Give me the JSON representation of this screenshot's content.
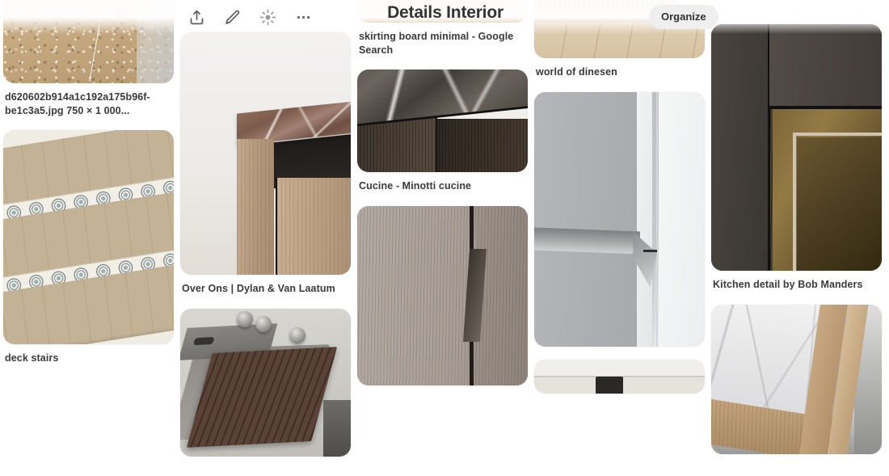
{
  "header": {
    "title": "Details Interior",
    "organize_label": "Organize",
    "tools": [
      {
        "name": "share-icon",
        "label": "Share"
      },
      {
        "name": "edit-pencil-icon",
        "label": "Edit"
      },
      {
        "name": "sparkle-icon",
        "label": "More ideas"
      },
      {
        "name": "more-options-icon",
        "label": "More options"
      }
    ]
  },
  "columns": [
    {
      "id": "column-1",
      "pins": [
        {
          "caption": "d620602b914a1c192a175b96f-be1c3a5.jpg 750 × 1 000...",
          "alt": "Terrazzo floor with wooden door frame"
        },
        {
          "caption": "deck stairs",
          "alt": "Wooden stairs with patterned tile risers"
        }
      ]
    },
    {
      "id": "column-2",
      "pins": [
        {
          "caption": "Over Ons | Dylan & Van Laatum",
          "alt": "Brown marble countertop on oak cabinet with black recess"
        },
        {
          "caption": "",
          "alt": "Concrete sink with dark wood slatted cover and metal knobs"
        }
      ]
    },
    {
      "id": "column-3",
      "pins": [
        {
          "caption": "skirting board minimal - Google Search",
          "alt": "Light wood floor with minimal white skirting board"
        },
        {
          "caption": "Cucine - Minotti cucine",
          "alt": "Dark marble countertop corner on dark wood cabinetry"
        },
        {
          "caption": "",
          "alt": "Grey wood grain cabinet doors with recessed groove handle"
        }
      ]
    },
    {
      "id": "column-4",
      "pins": [
        {
          "caption": "world of dinesen",
          "alt": "Slatted wood wall panel with light plank flooring"
        },
        {
          "caption": "",
          "alt": "White handleless cabinet with integrated groove pull"
        },
        {
          "caption": "",
          "alt": "Partially visible white surface with dark detail"
        }
      ]
    },
    {
      "id": "column-5",
      "pins": [
        {
          "caption": "Kitchen detail by Bob Manders",
          "alt": "Dark stained oak cabinetry with brass lined niche"
        },
        {
          "caption": "",
          "alt": "White marble slab with oak plywood edges"
        }
      ]
    }
  ],
  "colors": {
    "page_background": "#ffffff",
    "text": "#333333",
    "button_background": "#efefef"
  }
}
